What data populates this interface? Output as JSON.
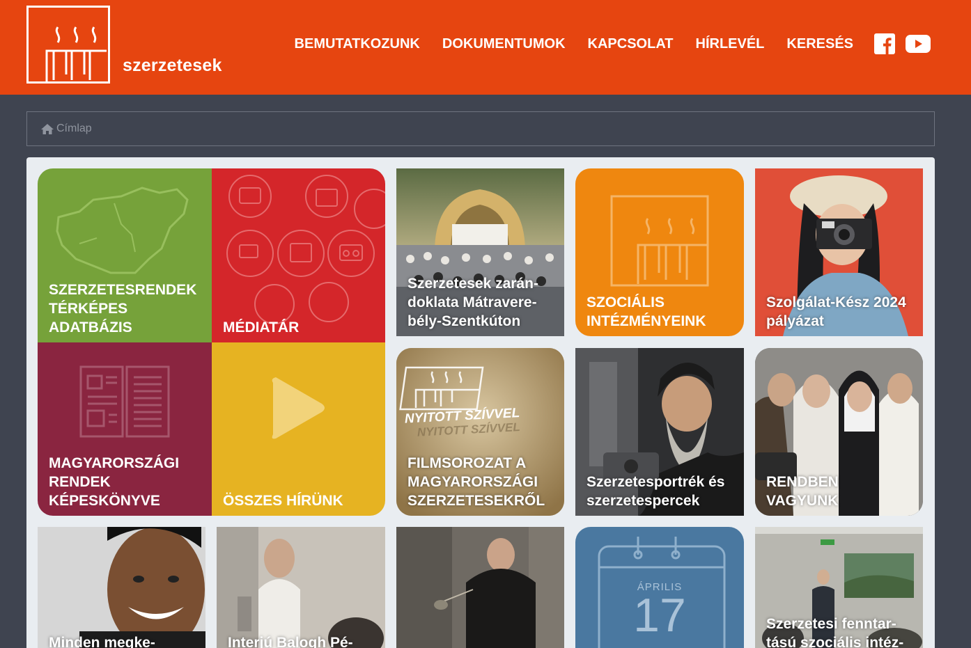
{
  "site": {
    "logo_text": "szerzetesek"
  },
  "nav": {
    "items": [
      "BEMUTATKOZUNK",
      "DOKUMENTUMOK",
      "KAPCSOLAT",
      "HÍRLEVÉL",
      "KERESÉS"
    ],
    "social": [
      "facebook-icon",
      "youtube-icon"
    ]
  },
  "breadcrumb": {
    "home": "Címlap"
  },
  "tiles": {
    "map": {
      "label": "SZERZETESRENDEK TÉRKÉPES ADATBÁZIS",
      "color": "#76a23a"
    },
    "media": {
      "label": "MÉDIATÁR",
      "color": "#d4262a"
    },
    "book": {
      "label": "MAGYARORSZÁGI RENDEK KÉPESKÖNYVE",
      "color": "#8a2540"
    },
    "news": {
      "label": "ÖSSZES HÍRÜNK",
      "color": "#e6b322"
    },
    "zarandoklat": {
      "label": "Szerzetesek zarán-doklata Mátravere-bély-Szentkúton"
    },
    "social": {
      "label": "SZOCIÁLIS INTÉZMÉNYEINK",
      "color": "#ef870f"
    },
    "szolgalat": {
      "label": "Szolgálat-Kész 2024 pályázat"
    },
    "film": {
      "label": "FILMSOROZAT A MAGYARORSZÁGI SZERZETESEKRŐL",
      "banner": "NYITOTT SZÍVVEL"
    },
    "portrek": {
      "label": "Szerzetesportrék és szerzetespercek"
    },
    "rendben": {
      "label": "RENDBEN VAGYUNK"
    },
    "minden": {
      "label": "Minden megke-"
    },
    "interju": {
      "label": "Interjú Balogh Pé-"
    },
    "liturgy": {
      "label": ""
    },
    "calendar": {
      "month": "ÁPRILIS",
      "day": "17",
      "color": "#4a78a0"
    },
    "fenntart": {
      "label": "Szerzetesi fenntar-tású szociális intéz-"
    }
  }
}
